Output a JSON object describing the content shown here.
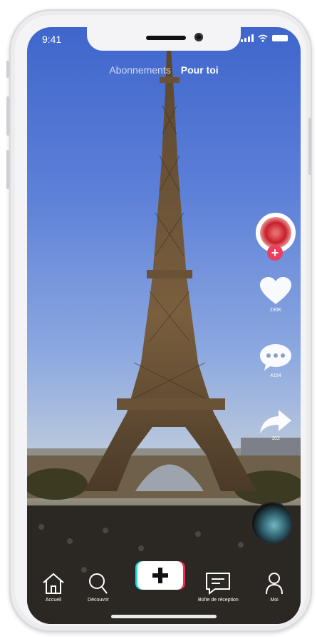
{
  "status_bar": {
    "time": "9:41"
  },
  "top_tabs": {
    "following": "Abonnements",
    "for_you": "Pour toi"
  },
  "actions": {
    "likes": "230K",
    "comments": "4154",
    "shares": "102"
  },
  "nav": {
    "home": "Accueil",
    "discover": "Découvrir",
    "inbox": "Boîte de réception",
    "profile": "Moi"
  },
  "icons": [
    "heart-icon",
    "comment-icon",
    "share-icon",
    "home-icon",
    "search-icon",
    "plus-icon",
    "inbox-icon",
    "person-icon"
  ],
  "colors": {
    "accent_red": "#ea3f5d",
    "accent_cyan": "#25d9e6",
    "accent_pink": "#ee2c57"
  }
}
